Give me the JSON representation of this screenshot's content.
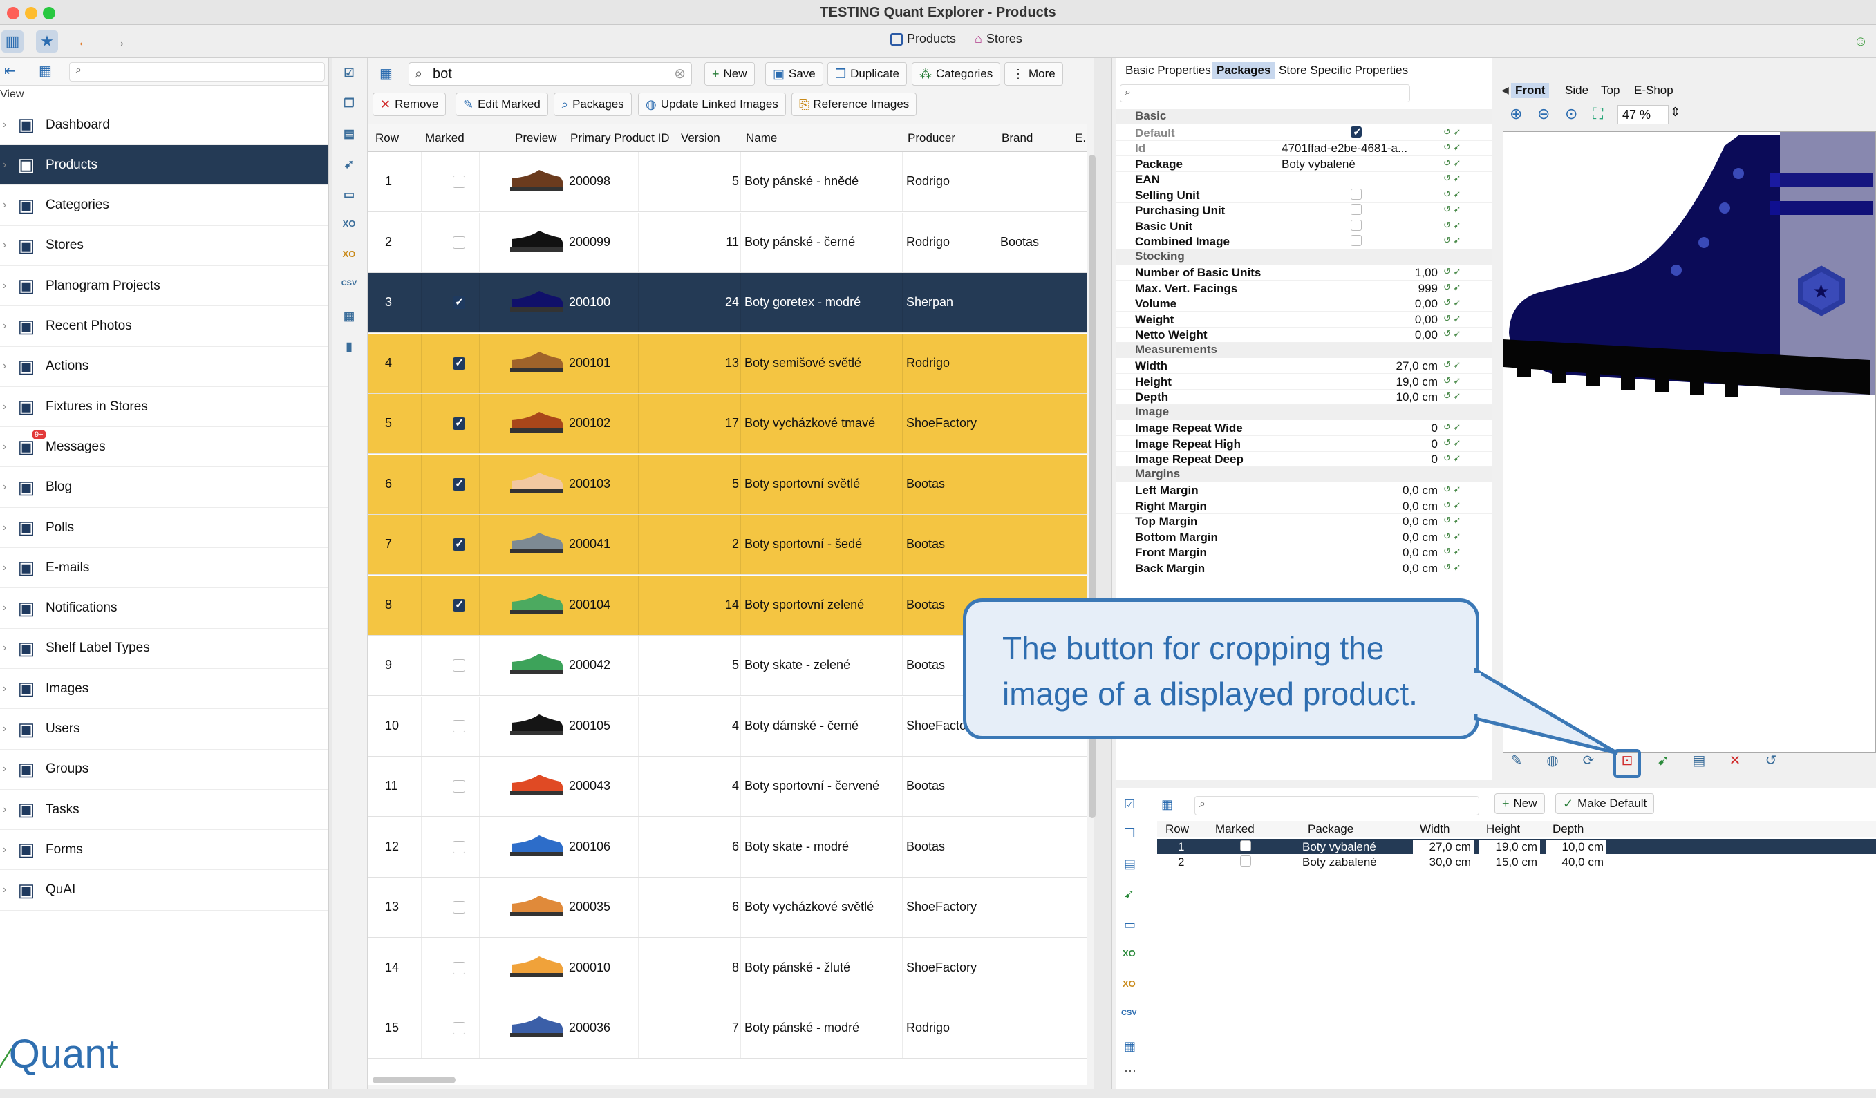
{
  "window": {
    "title": "TESTING Quant Explorer - Products"
  },
  "toolbar": {
    "tab_products": "Products",
    "tab_stores": "Stores"
  },
  "sidebar": {
    "view_label": "View",
    "items": [
      {
        "label": "Dashboard",
        "icon": "dashboard-icon"
      },
      {
        "label": "Products",
        "icon": "products-icon"
      },
      {
        "label": "Categories",
        "icon": "categories-icon"
      },
      {
        "label": "Stores",
        "icon": "stores-icon"
      },
      {
        "label": "Planogram Projects",
        "icon": "planogram-icon"
      },
      {
        "label": "Recent Photos",
        "icon": "camera-icon"
      },
      {
        "label": "Actions",
        "icon": "actions-icon"
      },
      {
        "label": "Fixtures in Stores",
        "icon": "fixtures-icon"
      },
      {
        "label": "Messages",
        "icon": "messages-icon",
        "badge": "9+"
      },
      {
        "label": "Blog",
        "icon": "blog-icon"
      },
      {
        "label": "Polls",
        "icon": "polls-icon"
      },
      {
        "label": "E-mails",
        "icon": "email-icon"
      },
      {
        "label": "Notifications",
        "icon": "notifications-icon"
      },
      {
        "label": "Shelf Label Types",
        "icon": "shelf-label-icon"
      },
      {
        "label": "Images",
        "icon": "images-icon"
      },
      {
        "label": "Users",
        "icon": "users-icon"
      },
      {
        "label": "Groups",
        "icon": "groups-icon"
      },
      {
        "label": "Tasks",
        "icon": "tasks-icon"
      },
      {
        "label": "Forms",
        "icon": "forms-icon"
      },
      {
        "label": "QuAI",
        "icon": "quai-icon"
      }
    ],
    "logo": "Quant"
  },
  "products": {
    "search_value": "bot",
    "buttons": {
      "new": "New",
      "save": "Save",
      "duplicate": "Duplicate",
      "categories": "Categories",
      "more": "More",
      "remove": "Remove",
      "edit_marked": "Edit Marked",
      "packages": "Packages",
      "update_linked": "Update Linked Images",
      "reference": "Reference Images"
    },
    "columns": [
      "Row",
      "Marked",
      "Preview",
      "Primary Product ID",
      "Version",
      "Name",
      "Producer",
      "Brand",
      "E."
    ],
    "rows": [
      {
        "row": "1",
        "marked": false,
        "id": "200098",
        "version": "5",
        "name": "Boty pánské - hnědé",
        "producer": "Rodrigo",
        "brand": "",
        "color": "#6b3b1e",
        "state": ""
      },
      {
        "row": "2",
        "marked": false,
        "id": "200099",
        "version": "11",
        "name": "Boty pánské - černé",
        "producer": "Rodrigo",
        "brand": "Bootas",
        "color": "#111111",
        "state": ""
      },
      {
        "row": "3",
        "marked": true,
        "id": "200100",
        "version": "24",
        "name": "Boty goretex - modré",
        "producer": "Sherpan",
        "brand": "",
        "color": "#10106a",
        "state": "sel"
      },
      {
        "row": "4",
        "marked": true,
        "id": "200101",
        "version": "13",
        "name": "Boty semišové světlé",
        "producer": "Rodrigo",
        "brand": "",
        "color": "#a0632a",
        "state": "marked"
      },
      {
        "row": "5",
        "marked": true,
        "id": "200102",
        "version": "17",
        "name": "Boty vycházkové tmavé",
        "producer": "ShoeFactory",
        "brand": "",
        "color": "#a8461a",
        "state": "marked"
      },
      {
        "row": "6",
        "marked": true,
        "id": "200103",
        "version": "5",
        "name": "Boty sportovní světlé",
        "producer": "Bootas",
        "brand": "",
        "color": "#f2c8a0",
        "state": "marked"
      },
      {
        "row": "7",
        "marked": true,
        "id": "200041",
        "version": "2",
        "name": "Boty sportovní - šedé",
        "producer": "Bootas",
        "brand": "",
        "color": "#7d8a93",
        "state": "marked"
      },
      {
        "row": "8",
        "marked": true,
        "id": "200104",
        "version": "14",
        "name": "Boty sportovní zelené",
        "producer": "Bootas",
        "brand": "",
        "color": "#4caa60",
        "state": "marked"
      },
      {
        "row": "9",
        "marked": false,
        "id": "200042",
        "version": "5",
        "name": "Boty skate - zelené",
        "producer": "Bootas",
        "brand": "",
        "color": "#3da35a",
        "state": ""
      },
      {
        "row": "10",
        "marked": false,
        "id": "200105",
        "version": "4",
        "name": "Boty dámské - černé",
        "producer": "ShoeFactor",
        "brand": "",
        "color": "#151515",
        "state": ""
      },
      {
        "row": "11",
        "marked": false,
        "id": "200043",
        "version": "4",
        "name": "Boty sportovní - červené",
        "producer": "Bootas",
        "brand": "",
        "color": "#e04a24",
        "state": ""
      },
      {
        "row": "12",
        "marked": false,
        "id": "200106",
        "version": "6",
        "name": "Boty skate - modré",
        "producer": "Bootas",
        "brand": "",
        "color": "#2d6dc9",
        "state": ""
      },
      {
        "row": "13",
        "marked": false,
        "id": "200035",
        "version": "6",
        "name": "Boty vycházkové světlé",
        "producer": "ShoeFactory",
        "brand": "",
        "color": "#e08a3a",
        "state": ""
      },
      {
        "row": "14",
        "marked": false,
        "id": "200010",
        "version": "8",
        "name": "Boty pánské - žluté",
        "producer": "ShoeFactory",
        "brand": "",
        "color": "#f0a23a",
        "state": ""
      },
      {
        "row": "15",
        "marked": false,
        "id": "200036",
        "version": "7",
        "name": "Boty pánské - modré",
        "producer": "Rodrigo",
        "brand": "",
        "color": "#3b5fa8",
        "state": ""
      }
    ]
  },
  "properties": {
    "tabs": [
      "Basic Properties",
      "Packages",
      "Store Specific Properties"
    ],
    "sections": [
      {
        "title": "Basic",
        "rows": [
          {
            "k": "Default",
            "v": "",
            "check": true,
            "dim": true
          },
          {
            "k": "Id",
            "v": "4701ffad-e2be-4681-a...",
            "dim": true
          },
          {
            "k": "Package",
            "v": "Boty vybalené"
          },
          {
            "k": "EAN",
            "v": ""
          },
          {
            "k": "Selling Unit",
            "v": "",
            "check": false
          },
          {
            "k": "Purchasing Unit",
            "v": "",
            "check": false
          },
          {
            "k": "Basic Unit",
            "v": "",
            "check": false
          },
          {
            "k": "Combined Image",
            "v": "",
            "check": false
          }
        ]
      },
      {
        "title": "Stocking",
        "rows": [
          {
            "k": "Number of Basic Units",
            "v": "1,00",
            "num": true
          },
          {
            "k": "Max. Vert. Facings",
            "v": "999",
            "num": true
          },
          {
            "k": "Volume",
            "v": "0,00",
            "num": true
          },
          {
            "k": "Weight",
            "v": "0,00",
            "num": true
          },
          {
            "k": "Netto Weight",
            "v": "0,00",
            "num": true
          }
        ]
      },
      {
        "title": "Measurements",
        "rows": [
          {
            "k": "Width",
            "v": "27,0 cm",
            "num": true
          },
          {
            "k": "Height",
            "v": "19,0 cm",
            "num": true
          },
          {
            "k": "Depth",
            "v": "10,0 cm",
            "num": true
          }
        ]
      },
      {
        "title": "Image",
        "rows": [
          {
            "k": "Image Repeat Wide",
            "v": "0",
            "num": true
          },
          {
            "k": "Image Repeat High",
            "v": "0",
            "num": true
          },
          {
            "k": "Image Repeat Deep",
            "v": "0",
            "num": true
          }
        ]
      },
      {
        "title": "Margins",
        "rows": [
          {
            "k": "Left Margin",
            "v": "0,0 cm",
            "num": true
          },
          {
            "k": "Right Margin",
            "v": "0,0 cm",
            "num": true
          },
          {
            "k": "Top Margin",
            "v": "0,0 cm",
            "num": true
          },
          {
            "k": "Bottom Margin",
            "v": "0,0 cm",
            "num": true
          },
          {
            "k": "Front Margin",
            "v": "0,0 cm",
            "num": true
          },
          {
            "k": "Back Margin",
            "v": "0,0 cm",
            "num": true
          }
        ]
      }
    ]
  },
  "preview": {
    "views": [
      "Front",
      "Side",
      "Top",
      "E-Shop"
    ],
    "zoom": "47 %"
  },
  "callout": {
    "text": "The button for cropping the image of a displayed product."
  },
  "packages": {
    "buttons": {
      "new": "New",
      "make_default": "Make Default"
    },
    "columns": [
      "Row",
      "Marked",
      "Package",
      "Width",
      "Height",
      "Depth"
    ],
    "rows": [
      {
        "row": "1",
        "name": "Boty vybalené",
        "width": "27,0 cm",
        "height": "19,0 cm",
        "depth": "10,0 cm",
        "sel": true
      },
      {
        "row": "2",
        "name": "Boty zabalené",
        "width": "30,0 cm",
        "height": "15,0 cm",
        "depth": "40,0 cm",
        "sel": false
      }
    ]
  },
  "colors": {
    "accent": "#243a55",
    "marked": "#f4c542",
    "callout": "#3b78b6"
  }
}
